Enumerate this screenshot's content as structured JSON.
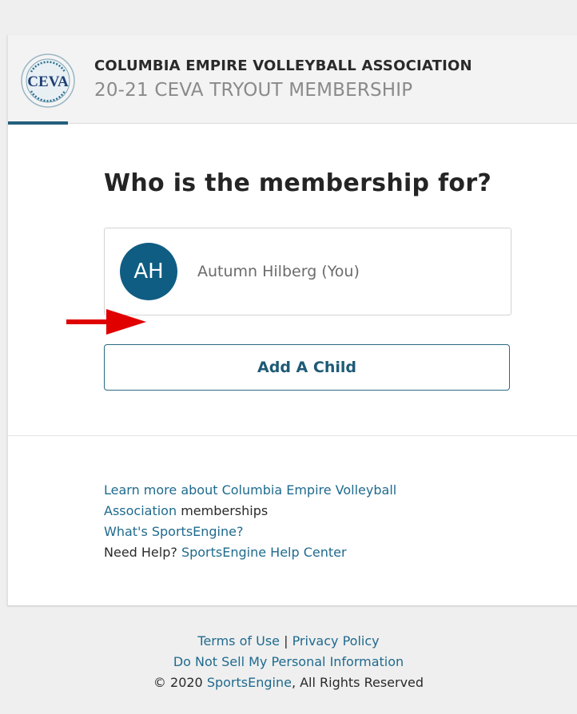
{
  "header": {
    "org_name": "COLUMBIA EMPIRE VOLLEYBALL ASSOCIATION",
    "product_name": "20-21 CEVA TRYOUT MEMBERSHIP",
    "logo_text": "CEVA",
    "logo_ring_text": "COLUMBIA EMPIRE VOLLEYBALL ASSOCIATION"
  },
  "main": {
    "title": "Who is the membership for?",
    "member": {
      "initials": "AH",
      "name": "Autumn Hilberg (You)"
    },
    "add_child_label": "Add A Child"
  },
  "help_links": {
    "learn_more_link": "Learn more about Columbia Empire Volleyball Association",
    "learn_more_suffix": " memberships",
    "whats_sportsengine": "What's SportsEngine?",
    "need_help_prefix": "Need Help? ",
    "help_center_link": "SportsEngine Help Center"
  },
  "footer": {
    "terms": "Terms of Use",
    "separator": " | ",
    "privacy": "Privacy Policy",
    "do_not_sell": "Do Not Sell My Personal Information",
    "copyright_prefix": "© 2020 ",
    "sportsengine_link": "SportsEngine",
    "copyright_suffix": ", All Rights Reserved"
  },
  "colors": {
    "accent": "#245f7e",
    "avatar": "#0f5d83",
    "link": "#1f6a8e",
    "annotation_arrow": "#e00000"
  }
}
